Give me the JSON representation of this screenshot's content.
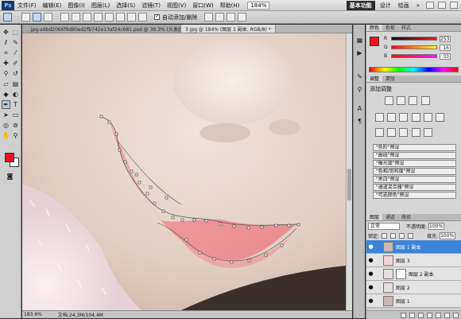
{
  "menubar": {
    "logo": "Ps",
    "items": [
      "文件(F)",
      "编辑(E)",
      "图像(I)",
      "图层(L)",
      "选择(S)",
      "滤镜(T)",
      "视图(V)",
      "窗口(W)",
      "帮助(H)"
    ],
    "zoom": "184%",
    "workspaces": {
      "active": "基本功能",
      "items": [
        "设计",
        "绘画"
      ]
    }
  },
  "options": {
    "auto_add_delete": "自动添加/删除"
  },
  "tabs": [
    {
      "label": "...jpg-a9bd2066f9d80ed2fb742e13af24c681.psd @ 39.3% (头发组, RGB/8) *",
      "active": false
    },
    {
      "label": "3.jpg @ 184% (图层 1 副本, RGB/8) *",
      "active": true
    }
  ],
  "status": {
    "zoom": "183.6%",
    "doc": "文档:24.3M/104.4M"
  },
  "color_panel": {
    "tabs": [
      "颜色",
      "色板",
      "样式"
    ],
    "r_label": "R",
    "g_label": "G",
    "b_label": "B",
    "r": "253",
    "g": "16",
    "b": "33",
    "swatch": "#fd1021"
  },
  "adjust_panel": {
    "tabs": [
      "调整",
      "蒙版"
    ],
    "title": "添加调整",
    "presets": [
      "\"色阶\"预设",
      "\"曲线\"预设",
      "\"曝光度\"预设",
      "\"色相/饱和度\"预设",
      "\"黑白\"预设",
      "\"通道混合器\"预设",
      "\"可选颜色\"预设"
    ]
  },
  "layers_panel": {
    "tabs": [
      "图层",
      "通道",
      "路径"
    ],
    "blend_mode": "正常",
    "opacity_label": "不透明度:",
    "opacity": "100%",
    "lock_label": "锁定:",
    "fill_label": "填充:",
    "fill": "100%",
    "layers": [
      {
        "name": "图层 1 副本",
        "selected": true
      },
      {
        "name": "图层 3",
        "selected": false
      },
      {
        "name": "图层 2 副本",
        "selected": false
      },
      {
        "name": "图层 2",
        "selected": false
      },
      {
        "name": "图层 1",
        "selected": false
      }
    ]
  },
  "colors": {
    "accent": "#3b84d8",
    "foreground": "#ee1122",
    "background": "#ffffff"
  }
}
